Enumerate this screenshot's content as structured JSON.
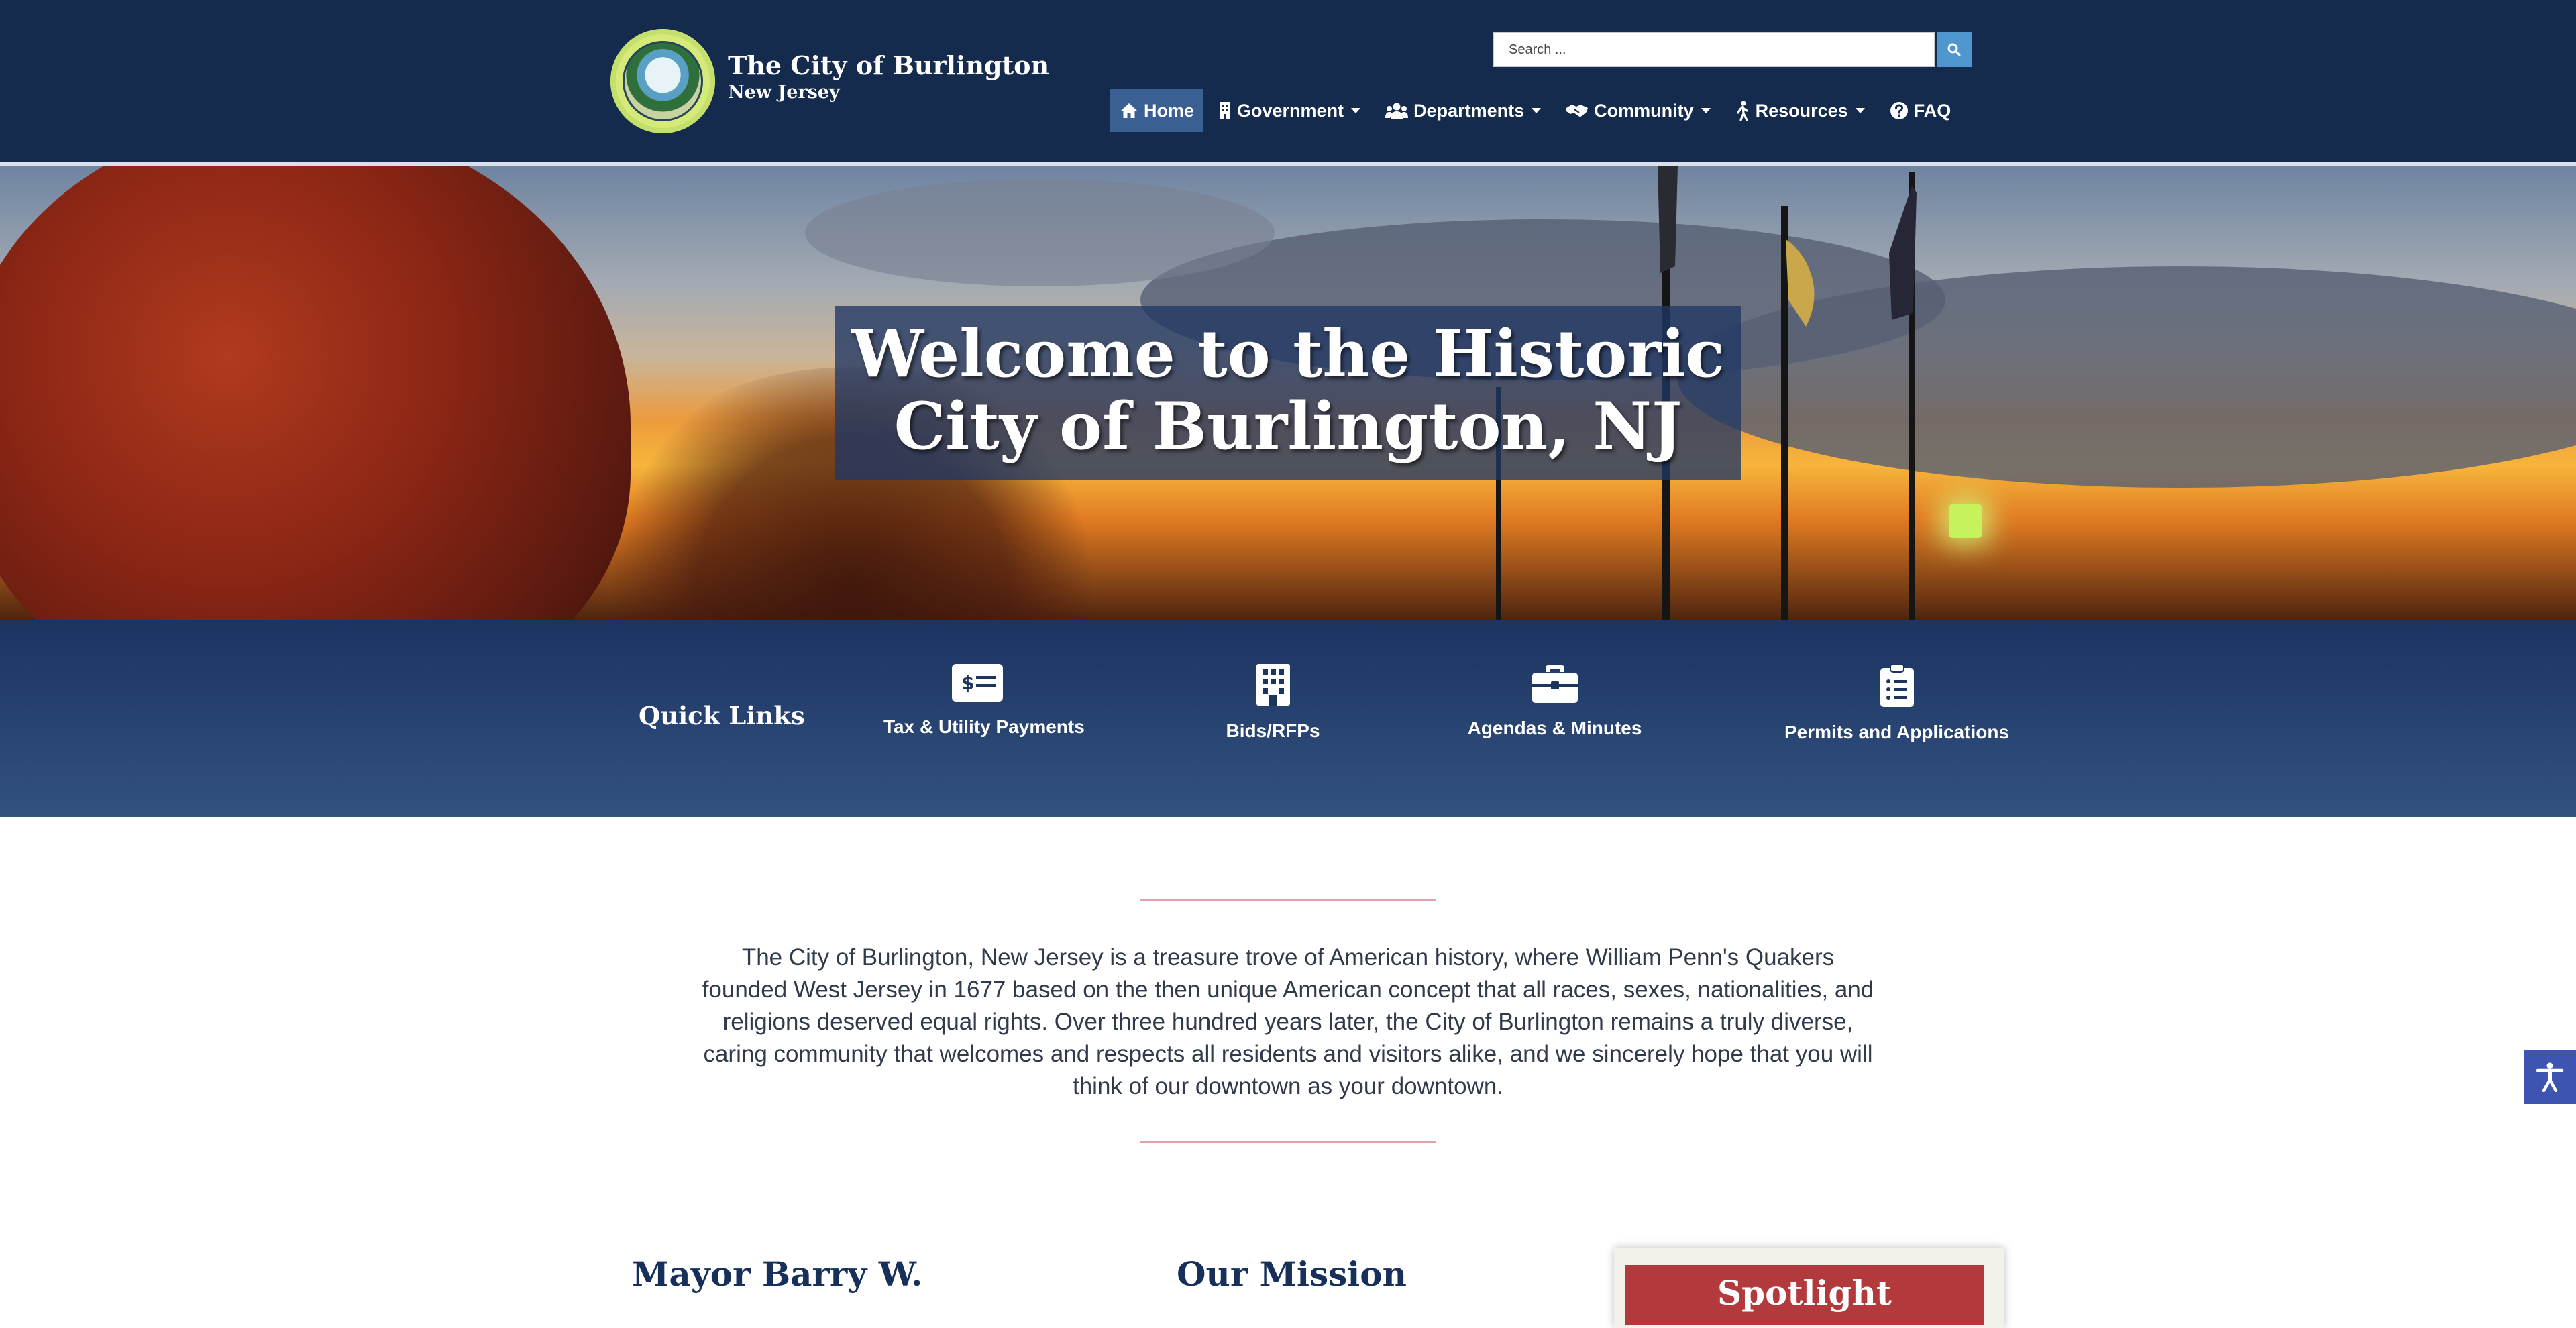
{
  "header": {
    "site_title": "The City of Burlington",
    "site_subtitle": "New Jersey",
    "search": {
      "placeholder": "Search ...",
      "button_icon": "search-icon"
    }
  },
  "nav": {
    "items": [
      {
        "label": "Home",
        "icon": "home-icon",
        "active": true
      },
      {
        "label": "Government",
        "icon": "building-icon",
        "has_dropdown": true
      },
      {
        "label": "Departments",
        "icon": "users-icon",
        "has_dropdown": true
      },
      {
        "label": "Community",
        "icon": "handshake-icon",
        "has_dropdown": true
      },
      {
        "label": "Resources",
        "icon": "walking-person-icon",
        "has_dropdown": true
      },
      {
        "label": "FAQ",
        "icon": "question-circle-icon"
      }
    ]
  },
  "hero": {
    "title_line1": "Welcome to the Historic",
    "title_line2": "City of Burlington, NJ"
  },
  "quick_links": {
    "title": "Quick Links",
    "items": [
      {
        "label": "Tax & Utility Payments",
        "icon": "money-check-icon"
      },
      {
        "label": "Bids/RFPs",
        "icon": "building-icon"
      },
      {
        "label": "Agendas & Minutes",
        "icon": "briefcase-icon"
      },
      {
        "label": "Permits and Applications",
        "icon": "clipboard-list-icon"
      }
    ]
  },
  "intro": {
    "text": "The City of Burlington, New Jersey is a treasure trove of American history, where William Penn's Quakers founded West Jersey in 1677 based on the then unique American concept that all races, sexes, nationalities, and religions deserved equal rights. Over three hundred years later, the City of Burlington remains a truly diverse, caring community that welcomes and respects all residents and visitors alike, and we sincerely hope that you will think of our downtown as your downtown."
  },
  "sections": {
    "mayor_heading": "Mayor Barry W.",
    "mission_heading": "Our Mission",
    "spotlight_heading": "Spotlight"
  },
  "accessibility": {
    "icon": "accessibility-icon"
  },
  "colors": {
    "header_bg": "#142b4d",
    "nav_active": "#3a5f93",
    "search_button": "#4f96cf",
    "quick_links_bg": "#1b3461",
    "divider": "#e2a4a8",
    "heading": "#17305a",
    "spotlight": "#b23a3d",
    "accessibility_button": "#3d55b0"
  }
}
